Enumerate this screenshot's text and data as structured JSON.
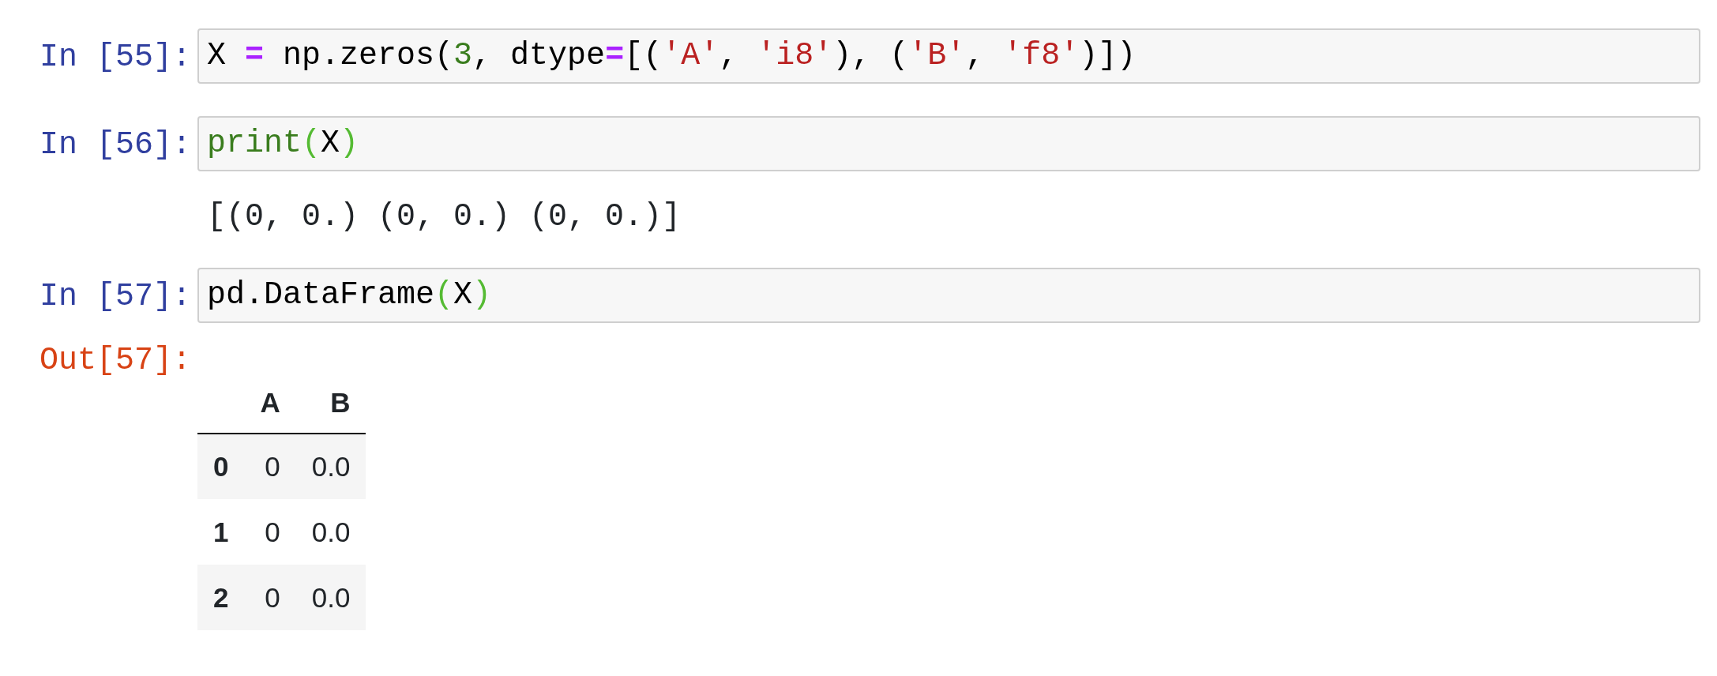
{
  "cells": [
    {
      "prompt": "In [55]:",
      "code": [
        {
          "kind": "plain",
          "text": "X "
        },
        {
          "kind": "operator",
          "text": "="
        },
        {
          "kind": "plain",
          "text": " np.zeros("
        },
        {
          "kind": "number",
          "text": "3"
        },
        {
          "kind": "plain",
          "text": ", dtype"
        },
        {
          "kind": "operator",
          "text": "="
        },
        {
          "kind": "plain",
          "text": "[("
        },
        {
          "kind": "string",
          "text": "'A'"
        },
        {
          "kind": "plain",
          "text": ", "
        },
        {
          "kind": "string",
          "text": "'i8'"
        },
        {
          "kind": "plain",
          "text": "), ("
        },
        {
          "kind": "string",
          "text": "'B'"
        },
        {
          "kind": "plain",
          "text": ", "
        },
        {
          "kind": "string",
          "text": "'f8'"
        },
        {
          "kind": "plain",
          "text": ")])"
        }
      ]
    },
    {
      "prompt": "In [56]:",
      "code": [
        {
          "kind": "builtin",
          "text": "print"
        },
        {
          "kind": "bracket",
          "text": "("
        },
        {
          "kind": "plain",
          "text": "X"
        },
        {
          "kind": "bracket",
          "text": ")"
        }
      ],
      "output": {
        "kind": "stream",
        "text": "[(0, 0.) (0, 0.) (0, 0.)]"
      }
    },
    {
      "prompt": "In [57]:",
      "code": [
        {
          "kind": "plain",
          "text": "pd.DataFrame"
        },
        {
          "kind": "bracket",
          "text": "("
        },
        {
          "kind": "plain",
          "text": "X"
        },
        {
          "kind": "bracket",
          "text": ")"
        }
      ],
      "output": {
        "kind": "dataframe",
        "prompt": "Out[57]:",
        "columns": [
          "A",
          "B"
        ],
        "rows": [
          {
            "index": "0",
            "values": [
              "0",
              "0.0"
            ]
          },
          {
            "index": "1",
            "values": [
              "0",
              "0.0"
            ]
          },
          {
            "index": "2",
            "values": [
              "0",
              "0.0"
            ]
          }
        ]
      }
    }
  ]
}
